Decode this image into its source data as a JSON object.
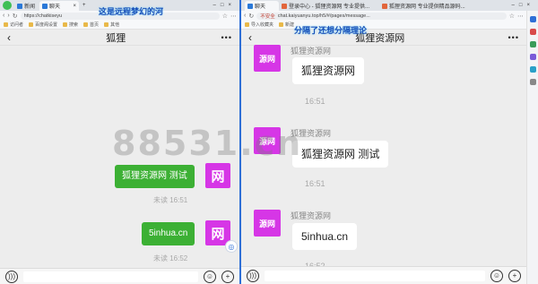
{
  "left": {
    "tabs": [
      {
        "label": "新闻"
      },
      {
        "label": "聊天"
      }
    ],
    "url": "https://chatkiseyu",
    "favorites": [
      "访问者",
      "百度阁设置",
      "搜索",
      "首页",
      "其他"
    ],
    "header_title": "狐狸",
    "messages": [
      {
        "text": "狐狸资源网 测试",
        "avatar": "网",
        "status": "未读 16:51"
      },
      {
        "text": "5inhua.cn",
        "avatar": "网",
        "status": "未读 16:52"
      }
    ]
  },
  "right": {
    "tabs": [
      {
        "label": "聊天"
      },
      {
        "label": "登录中心 - 狐狸资源网 专业提供..."
      },
      {
        "label": "狐狸资源网 专业提供精品源码..."
      }
    ],
    "url": "chat.kaiyuanyu.top/h5/#/pages/message...",
    "security": "不安全",
    "favorites": [
      "导入收藏夹",
      "新建"
    ],
    "header_title": "狐狸资源网",
    "messages": [
      {
        "sender": "狐狸资源网",
        "text": "狐狸资源网",
        "avatar": "源网",
        "time": "16:51"
      },
      {
        "sender": "狐狸资源网",
        "text": "狐狸资源网 测试",
        "avatar": "源网",
        "time": "16:51"
      },
      {
        "sender": "狐狸资源网",
        "text": "5inhua.cn",
        "avatar": "源网",
        "time": "16:52"
      }
    ]
  },
  "overlays": {
    "caption_left": "这是远程梦幻的河",
    "caption_right": "分隔了还想分隔理论",
    "watermark": "88531.cn"
  },
  "colors": {
    "green_bubble": "#3cb034",
    "avatar": "#d636e6",
    "divider": "#2f6fd6"
  }
}
